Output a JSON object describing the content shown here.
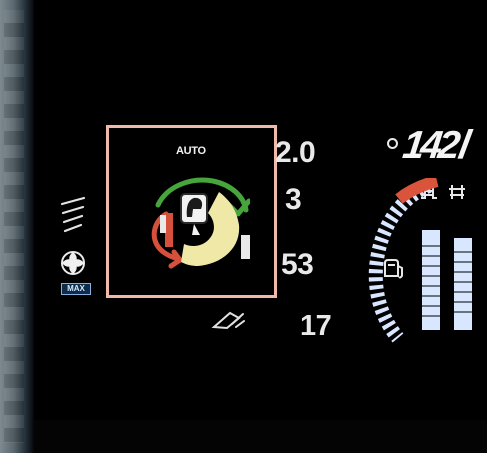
{
  "climate": {
    "mode": "AUTO"
  },
  "readouts": {
    "value_1": "2.0",
    "value_2": "3",
    "value_3": "53",
    "value_4": "17"
  },
  "speed": {
    "digits": "142Ⅰ"
  },
  "badge": {
    "max": "MAX"
  },
  "icons": {
    "defrost": "rear-defrost-icon",
    "fan": "fan-icon",
    "flow": "air-flow-icon",
    "seat": "seat-icon",
    "fuel": "fuel-icon",
    "gauge": "gauge-icon",
    "door": "door-icon"
  },
  "colors": {
    "box_border": "#f0b9aa",
    "accent_red": "#d9543b",
    "accent_green": "#54b33f",
    "accent_yellow": "#f1eca8",
    "bar_blue": "#d9e6ff"
  }
}
